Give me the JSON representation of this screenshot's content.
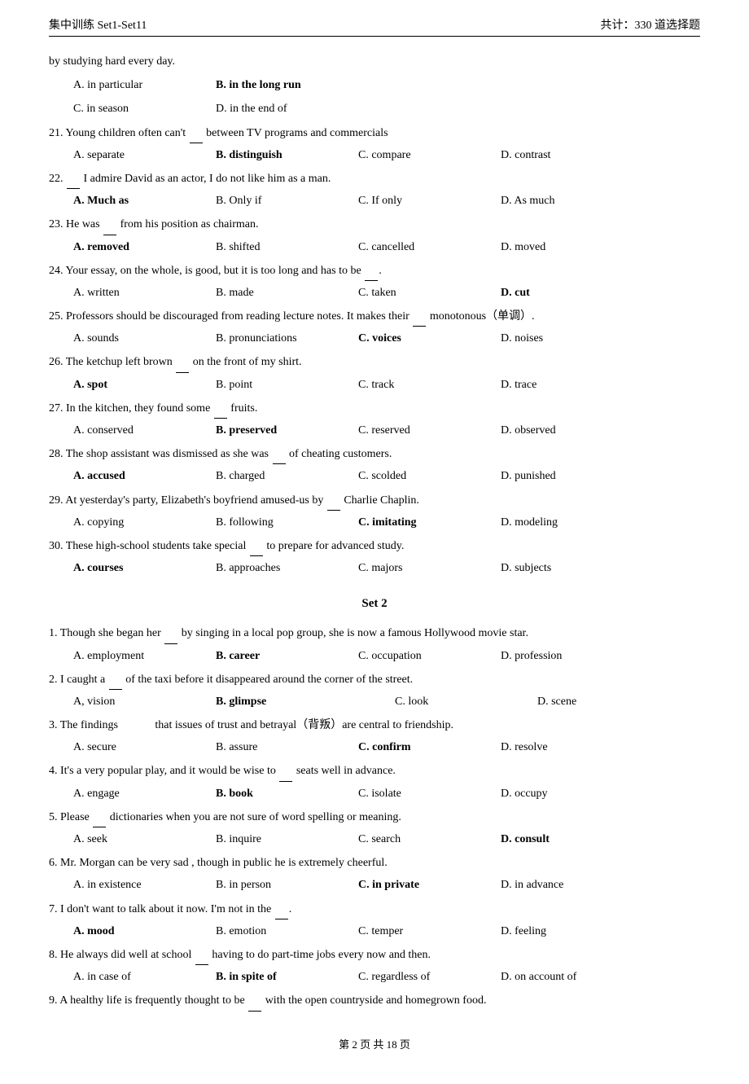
{
  "header": {
    "left": "集中训练 Set1-Set11",
    "right": "共计：330 道选择题"
  },
  "intro_line": "by studying hard every day.",
  "questions_set1_tail": [
    {
      "number": "",
      "text": "",
      "options": [
        {
          "label": "A.",
          "text": "in particular",
          "bold": false
        },
        {
          "label": "B.",
          "text": "in the long run",
          "bold": true
        },
        {
          "label": "C.",
          "text": "in season",
          "bold": false
        },
        {
          "label": "D.",
          "text": "in the end of",
          "bold": false
        }
      ]
    },
    {
      "number": "21.",
      "text": "Young children often can't __ between TV programs and commercials",
      "options": [
        {
          "label": "A.",
          "text": "separate",
          "bold": false
        },
        {
          "label": "B.",
          "text": "distinguish",
          "bold": true
        },
        {
          "label": "C.",
          "text": "compare",
          "bold": false
        },
        {
          "label": "D.",
          "text": "contrast",
          "bold": false
        }
      ]
    },
    {
      "number": "22.",
      "text": "__ I admire David as an actor, I do not like him as a man.",
      "options": [
        {
          "label": "A.",
          "text": "Much as",
          "bold": true
        },
        {
          "label": "B.",
          "text": "Only if",
          "bold": false
        },
        {
          "label": "C.",
          "text": "If only",
          "bold": false
        },
        {
          "label": "D.",
          "text": "As much",
          "bold": false
        }
      ]
    },
    {
      "number": "23.",
      "text": "He was __ from his position as chairman.",
      "options": [
        {
          "label": "A.",
          "text": "removed",
          "bold": true
        },
        {
          "label": "B.",
          "text": "shifted",
          "bold": false
        },
        {
          "label": "C.",
          "text": "cancelled",
          "bold": false
        },
        {
          "label": "D.",
          "text": "moved",
          "bold": false
        }
      ]
    },
    {
      "number": "24.",
      "text": "Your essay, on the whole, is good, but it is too long and has to be __.",
      "options": [
        {
          "label": "A.",
          "text": "written",
          "bold": false
        },
        {
          "label": "B.",
          "text": "made",
          "bold": false
        },
        {
          "label": "C.",
          "text": "taken",
          "bold": false
        },
        {
          "label": "D.",
          "text": "cut",
          "bold": true
        }
      ]
    },
    {
      "number": "25.",
      "text": "Professors should be discouraged from reading lecture notes. It makes their __ monotonous（单调）.",
      "multiline": true,
      "options": [
        {
          "label": "A.",
          "text": "sounds",
          "bold": false
        },
        {
          "label": "B.",
          "text": "pronunciations",
          "bold": false
        },
        {
          "label": "C.",
          "text": "voices",
          "bold": true
        },
        {
          "label": "D.",
          "text": "noises",
          "bold": false
        }
      ]
    },
    {
      "number": "26.",
      "text": "The ketchup left brown __ on the front of my shirt.",
      "options": [
        {
          "label": "A.",
          "text": "spot",
          "bold": true
        },
        {
          "label": "B.",
          "text": "point",
          "bold": false
        },
        {
          "label": "C.",
          "text": "track",
          "bold": false
        },
        {
          "label": "D.",
          "text": "trace",
          "bold": false
        }
      ]
    },
    {
      "number": "27.",
      "text": "In the kitchen, they found some __ fruits.",
      "options": [
        {
          "label": "A.",
          "text": "conserved",
          "bold": false
        },
        {
          "label": "B.",
          "text": "preserved",
          "bold": true
        },
        {
          "label": "C.",
          "text": "reserved",
          "bold": false
        },
        {
          "label": "D.",
          "text": "observed",
          "bold": false
        }
      ]
    },
    {
      "number": "28.",
      "text": "The shop assistant was dismissed as she was __ of cheating customers.",
      "options": [
        {
          "label": "A.",
          "text": "accused",
          "bold": true
        },
        {
          "label": "B.",
          "text": "charged",
          "bold": false
        },
        {
          "label": "C.",
          "text": "scolded",
          "bold": false
        },
        {
          "label": "D.",
          "text": "punished",
          "bold": false
        }
      ]
    },
    {
      "number": "29.",
      "text": "At yesterday's party, Elizabeth's boyfriend amused-us by __ Charlie Chaplin.",
      "options": [
        {
          "label": "A.",
          "text": "copying",
          "bold": false
        },
        {
          "label": "B.",
          "text": "following",
          "bold": false
        },
        {
          "label": "C.",
          "text": "imitating",
          "bold": true
        },
        {
          "label": "D.",
          "text": "modeling",
          "bold": false
        }
      ]
    },
    {
      "number": "30.",
      "text": "These high-school students take special __ to prepare for advanced study.",
      "options": [
        {
          "label": "A.",
          "text": "courses",
          "bold": true
        },
        {
          "label": "B.",
          "text": "approaches",
          "bold": false
        },
        {
          "label": "C.",
          "text": "majors",
          "bold": false
        },
        {
          "label": "D.",
          "text": "subjects",
          "bold": false
        }
      ]
    }
  ],
  "set2_title": "Set 2",
  "questions_set2": [
    {
      "number": "1.",
      "text": "Though she began her __ by singing in a local pop group, she is now a famous Hollywood movie star.",
      "multiline": true,
      "options": [
        {
          "label": "A.",
          "text": "employment",
          "bold": false
        },
        {
          "label": "B.",
          "text": "career",
          "bold": true
        },
        {
          "label": "C.",
          "text": "occupation",
          "bold": false
        },
        {
          "label": "D.",
          "text": "profession",
          "bold": false
        }
      ]
    },
    {
      "number": "2.",
      "text": "I caught a __ of the taxi before it disappeared around the corner of the street.",
      "options": [
        {
          "label": "A,",
          "text": "vision",
          "bold": false
        },
        {
          "label": "B.",
          "text": "glimpse",
          "bold": true
        },
        {
          "label": "C.",
          "text": "look",
          "bold": false
        },
        {
          "label": "D.",
          "text": "scene",
          "bold": false
        }
      ]
    },
    {
      "number": "3.",
      "text": "The findings           that issues of trust and betrayal（背叛）are central to friendship.",
      "options": [
        {
          "label": "A.",
          "text": "secure",
          "bold": false
        },
        {
          "label": "B.",
          "text": "assure",
          "bold": false
        },
        {
          "label": "C.",
          "text": "confirm",
          "bold": true
        },
        {
          "label": "D.",
          "text": "resolve",
          "bold": false
        }
      ]
    },
    {
      "number": "4.",
      "text": "It's a very popular play, and it would be wise to __ seats well in advance.",
      "options": [
        {
          "label": "A.",
          "text": "engage",
          "bold": false
        },
        {
          "label": "B.",
          "text": "book",
          "bold": true
        },
        {
          "label": "C.",
          "text": "isolate",
          "bold": false
        },
        {
          "label": "D.",
          "text": "occupy",
          "bold": false
        }
      ]
    },
    {
      "number": "5.",
      "text": "Please __ dictionaries when you are not sure of word spelling or meaning.",
      "options": [
        {
          "label": "A.",
          "text": "seek",
          "bold": false
        },
        {
          "label": "B.",
          "text": "inquire",
          "bold": false
        },
        {
          "label": "C.",
          "text": "search",
          "bold": false
        },
        {
          "label": "D.",
          "text": "consult",
          "bold": true
        }
      ]
    },
    {
      "number": "6.",
      "text": "Mr. Morgan can be very sad , though in public he is extremely cheerful.",
      "options": [
        {
          "label": "A.",
          "text": "in existence",
          "bold": false
        },
        {
          "label": "B.",
          "text": "in person",
          "bold": false
        },
        {
          "label": "C.",
          "text": "in private",
          "bold": true
        },
        {
          "label": "D.",
          "text": "in advance",
          "bold": false
        }
      ]
    },
    {
      "number": "7.",
      "text": "I don't want to talk about it now. I'm not in the __.",
      "options": [
        {
          "label": "A.",
          "text": "mood",
          "bold": true
        },
        {
          "label": "B.",
          "text": "emotion",
          "bold": false
        },
        {
          "label": "C.",
          "text": "temper",
          "bold": false
        },
        {
          "label": "D.",
          "text": "feeling",
          "bold": false
        }
      ]
    },
    {
      "number": "8.",
      "text": "He always did well at school __ having to do part-time jobs every now and then.",
      "options": [
        {
          "label": "A.",
          "text": "in case of",
          "bold": false
        },
        {
          "label": "B.",
          "text": "in spite of",
          "bold": true
        },
        {
          "label": "C.",
          "text": "regardless of",
          "bold": false
        },
        {
          "label": "D.",
          "text": "on account of",
          "bold": false
        }
      ]
    },
    {
      "number": "9.",
      "text": "A healthy life is frequently thought to be __ with the open countryside and homegrown food.",
      "options": []
    }
  ],
  "footer": {
    "text": "第 2 页 共 18 页"
  }
}
